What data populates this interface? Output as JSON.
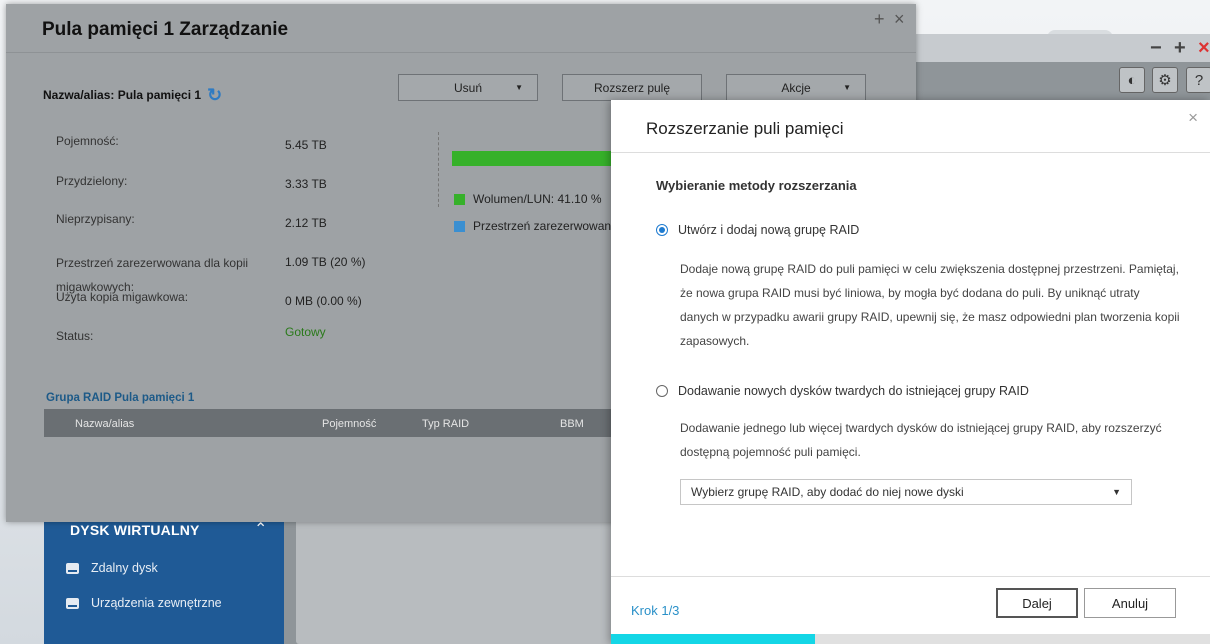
{
  "background": {
    "sidebar": {
      "title": "DYSK WIRTUALNY",
      "items": [
        {
          "label": "Zdalny dysk",
          "icon": "disk-icon"
        },
        {
          "label": "Urządzenia zewnętrzne",
          "icon": "external-device-icon"
        }
      ]
    }
  },
  "management": {
    "title": "Pula pamięci 1 Zarządzanie",
    "alias_label": "Nazwa/alias: Pula pamięci 1",
    "buttons": {
      "remove": "Usuń",
      "expand": "Rozszerz pulę",
      "actions": "Akcje"
    },
    "info": [
      {
        "label": "Pojemność:",
        "value": "5.45 TB"
      },
      {
        "label": "Przydzielony:",
        "value": "3.33 TB"
      },
      {
        "label": "Nieprzypisany:",
        "value": "2.12 TB"
      },
      {
        "label": "Przestrzeń zarezerwowana dla kopii migawkowych:",
        "value": "1.09 TB (20 %)"
      },
      {
        "label": "Użyta kopia migawkowa:",
        "value": "0 MB (0.00 %)"
      },
      {
        "label": "Status:",
        "value": "Gotowy"
      }
    ],
    "legend": [
      {
        "label": "Wolumen/LUN:  41.10 %",
        "color": "#36b12a"
      },
      {
        "label": "Przestrzeń zarezerwowana",
        "color": "#3a8fd1"
      }
    ],
    "usage_percent": 41.1,
    "raid_group": {
      "title": "Grupa RAID Pula pamięci 1",
      "columns": [
        "Nazwa/alias",
        "Pojemność",
        "Typ RAID",
        "BBM"
      ]
    }
  },
  "modal": {
    "title": "Rozszerzanie puli pamięci",
    "section_title": "Wybieranie metody rozszerzania",
    "options": [
      {
        "label": "Utwórz i dodaj nową grupę RAID",
        "checked": true,
        "description": "Dodaje nową grupę RAID do puli pamięci w celu zwiększenia dostępnej przestrzeni. Pamiętaj, że nowa grupa RAID musi być liniowa, by mogła być dodana do puli. By uniknąć utraty danych w przypadku awarii grupy RAID, upewnij się, że masz odpowiedni plan tworzenia kopii zapasowych."
      },
      {
        "label": "Dodawanie nowych dysków twardych do istniejącej grupy RAID",
        "checked": false,
        "description": "Dodawanie jednego lub więcej twardych dysków do istniejącej grupy RAID, aby rozszerzyć dostępną pojemność puli pamięci."
      }
    ],
    "select_value": "Wybierz grupę RAID, aby dodać do niej nowe dyski",
    "step": "Krok 1/3",
    "next_button": "Dalej",
    "cancel_button": "Anuluj",
    "progress_fraction": 0.34,
    "accent_color": "#14d6e6"
  }
}
